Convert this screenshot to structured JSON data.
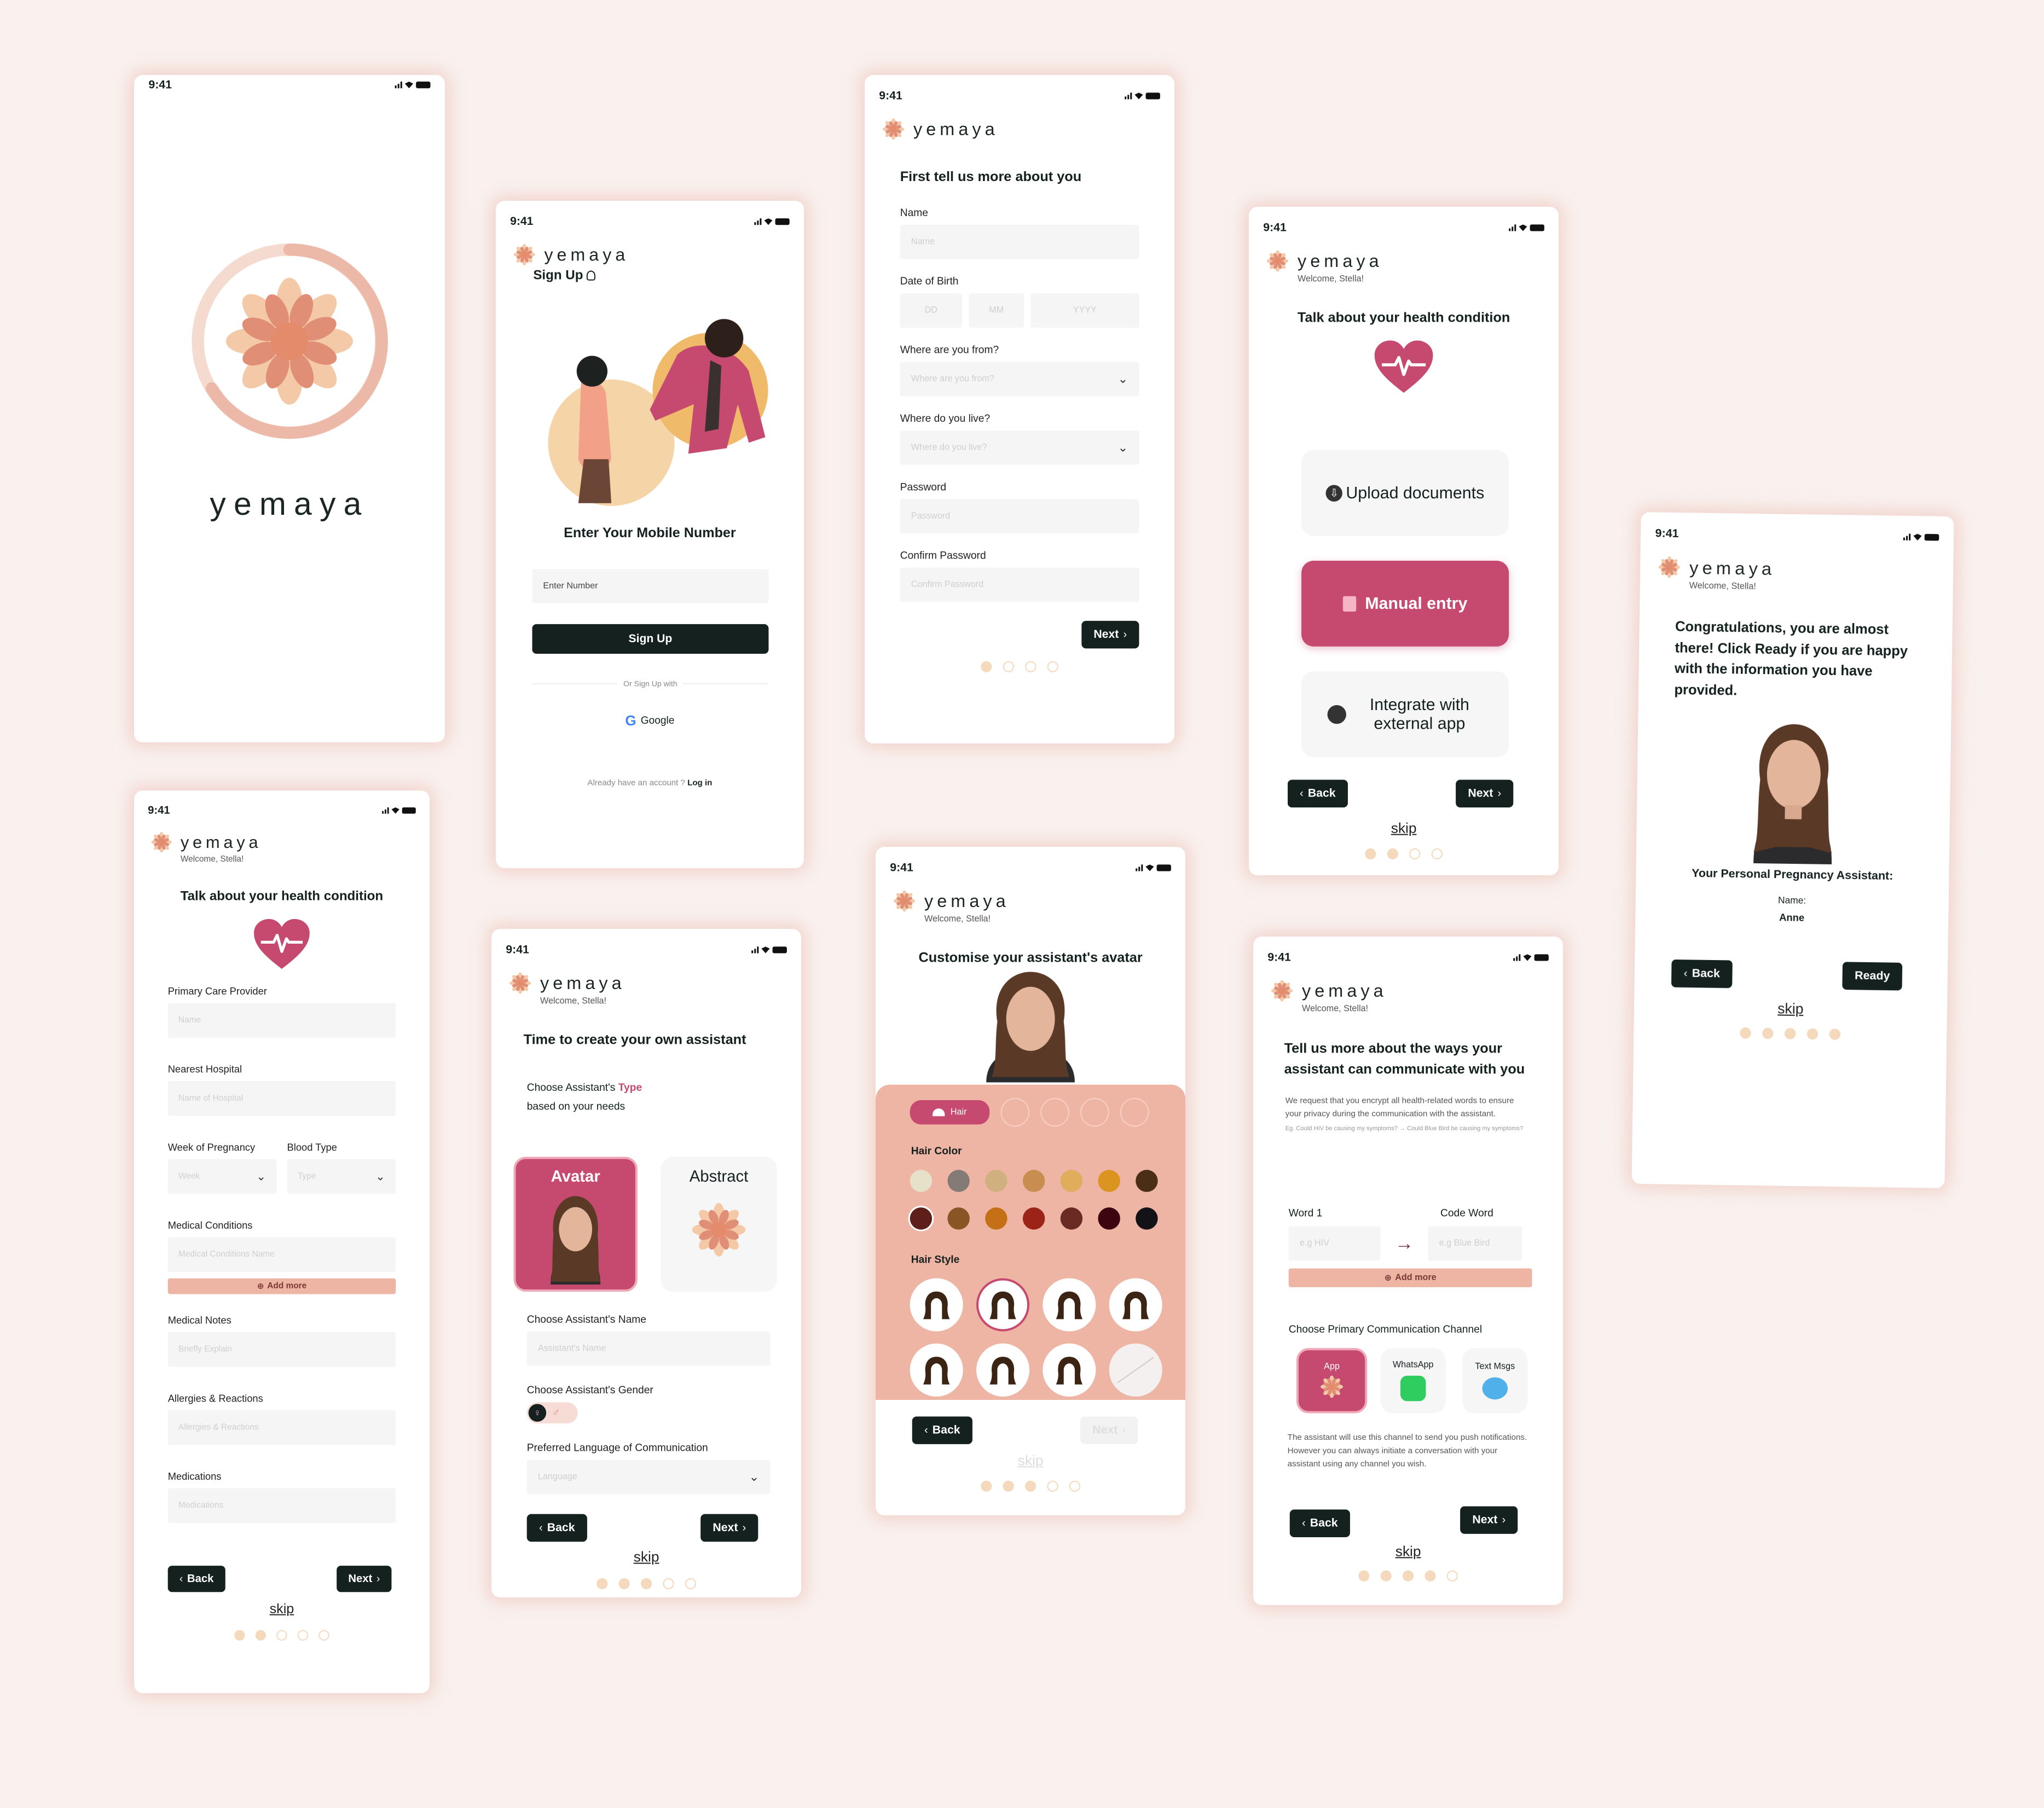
{
  "app": {
    "brand": "yemaya",
    "time": "9:41",
    "welcome": "Welcome, Stella!"
  },
  "colors": {
    "background": "#f9f1ee",
    "dark": "#14211f",
    "accent": "#c64a6f",
    "peach": "#eeb4a4",
    "dot": "#f5d9bd"
  },
  "nav": {
    "back": "Back",
    "next": "Next",
    "skip": "skip",
    "ready": "Ready"
  },
  "splash": {
    "brand": "yemaya"
  },
  "signup": {
    "title": "Sign Up",
    "heading": "Enter Your Mobile Number",
    "placeholder": "Enter Number",
    "button": "Sign Up",
    "divider": "Or Sign Up with",
    "google": "Google",
    "already": "Already have an account ?",
    "login": "Log in"
  },
  "about": {
    "heading": "First tell us more about you",
    "name_label": "Name",
    "name_ph": "Name",
    "dob_label": "Date of Birth",
    "dd": "DD",
    "mm": "MM",
    "yyyy": "YYYY",
    "from_label": "Where are you from?",
    "from_ph": "Where are you from?",
    "live_label": "Where do you live?",
    "live_ph": "Where do you live?",
    "pw_label": "Password",
    "pw_ph": "Password",
    "cpw_label": "Confirm Password",
    "cpw_ph": "Confirm Password"
  },
  "health_choice": {
    "heading": "Talk about your health condition",
    "upload": "Upload documents",
    "manual": "Manual entry",
    "integrate": "Integrate with external app"
  },
  "health_form": {
    "heading": "Talk about your health condition",
    "pcp": "Primary Care Provider",
    "pcp_ph": "Name",
    "hosp": "Nearest Hospital",
    "hosp_ph": "Name of Hospital",
    "week": "Week of Pregnancy",
    "week_ph": "Week",
    "blood": "Blood Type",
    "blood_ph": "Type",
    "cond": "Medical Conditions",
    "cond_ph": "Medical Conditions Name",
    "add_more": "Add more",
    "notes": "Medical Notes",
    "notes_ph": "Briefly Explain",
    "allergy": "Allergies & Reactions",
    "allergy_ph": "Allergies & Reactions",
    "meds": "Medications",
    "meds_ph": "Medications"
  },
  "create": {
    "heading": "Time to create your own assistant",
    "type_a": "Choose Assistant's",
    "type_b": "Type",
    "type_c": "based on your needs",
    "avatar": "Avatar",
    "abstract": "Abstract",
    "name_label": "Choose Assistant's Name",
    "name_ph": "Assistant's Name",
    "gender_label": "Choose Assistant's Gender",
    "lang_label": "Preferred Language of Communication",
    "lang_ph": "Language"
  },
  "customise": {
    "heading": "Customise your assistant's avatar",
    "tab": "Hair",
    "hair_color": "Hair Color",
    "hair_style": "Hair Style",
    "swatches": [
      "#e6e2c9",
      "#857b76",
      "#cfb07e",
      "#c78e50",
      "#e0ad5c",
      "#dc9420",
      "#4a2f16",
      "#5e1f1a",
      "#8b5425",
      "#c56f17",
      "#9c2318",
      "#6b2b25",
      "#3d0510",
      "#121217"
    ]
  },
  "communicate": {
    "heading": "Tell us more about the ways your assistant can communicate with you",
    "note": "We request that you encrypt all health-related words to ensure your privacy during the communication with the assistant.",
    "example": "Eg. Could HIV be causing my symptoms? → Could Blue Bird be causing my symptoms?",
    "word": "Word 1",
    "word_ph": "e.g HIV",
    "code": "Code Word",
    "code_ph": "e.g Blue Bird",
    "add_more": "Add more",
    "channel_label": "Choose Primary Communication Channel",
    "app": "App",
    "whatsapp": "WhatsApp",
    "text": "Text Msgs",
    "footer": "The assistant will use this channel to send you push notifications. However you can always initiate a conversation with your assistant using any channel you wish."
  },
  "congrats": {
    "message": "Congratulations, you are almost there! Click Ready if you are happy with the information you have provided.",
    "assistant_label": "Your Personal Pregnancy Assistant:",
    "name_label": "Name:",
    "name": "Anne"
  }
}
